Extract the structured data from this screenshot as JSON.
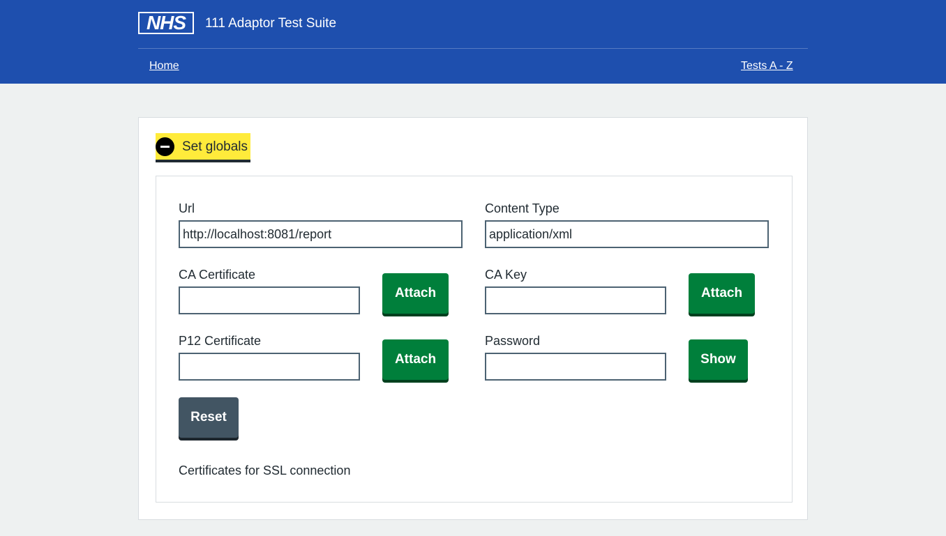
{
  "header": {
    "logo_text": "NHS",
    "service_name": "111 Adaptor Test Suite",
    "nav": {
      "home": "Home",
      "tests_az": "Tests A - Z"
    }
  },
  "details": {
    "summary": "Set globals",
    "expanded": true
  },
  "form": {
    "url": {
      "label": "Url",
      "value": "http://localhost:8081/report"
    },
    "content_type": {
      "label": "Content Type",
      "value": "application/xml"
    },
    "ca_certificate": {
      "label": "CA Certificate",
      "value": "",
      "button": "Attach"
    },
    "ca_key": {
      "label": "CA Key",
      "value": "",
      "button": "Attach"
    },
    "p12_certificate": {
      "label": "P12 Certificate",
      "value": "",
      "button": "Attach"
    },
    "password": {
      "label": "Password",
      "value": "",
      "button": "Show"
    },
    "reset_button": "Reset",
    "hint": "Certificates for SSL connection"
  },
  "colors": {
    "header_blue": "#1e4fae",
    "button_green": "#007f3b",
    "button_grey": "#425563",
    "summary_yellow": "#ffeb3b"
  }
}
